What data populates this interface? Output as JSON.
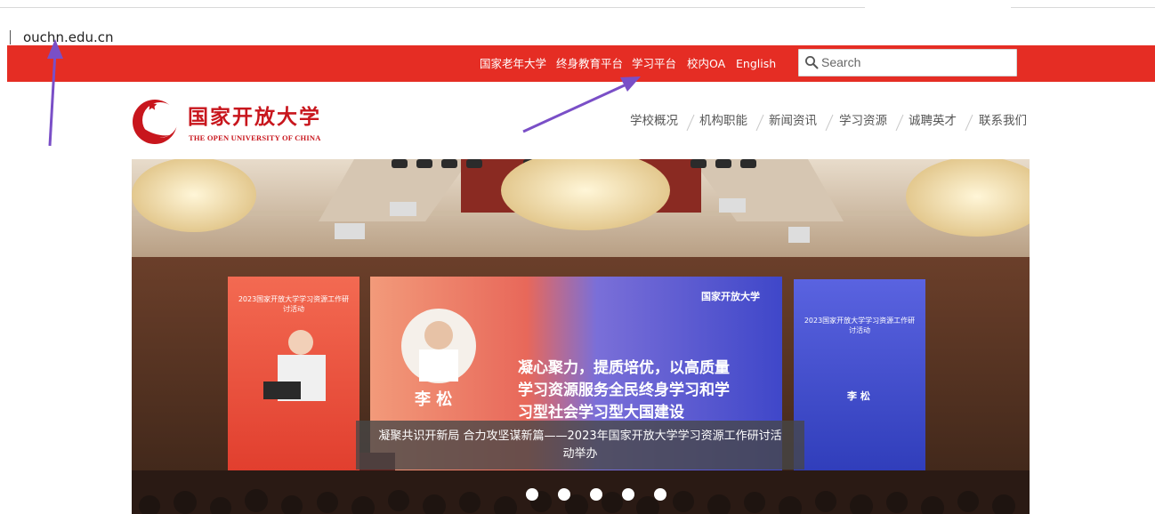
{
  "browser": {
    "url": "ouchn.edu.cn"
  },
  "utility_nav": {
    "links": [
      "国家老年大学",
      "终身教育平台",
      "学习平台",
      "校内OA",
      "English"
    ],
    "search_placeholder": "Search"
  },
  "logo": {
    "name_cn": "国家开放大学",
    "name_en": "THE OPEN UNIVERSITY OF CHINA"
  },
  "main_nav": [
    "学校概况",
    "机构职能",
    "新闻资讯",
    "学习资源",
    "诚聘英才",
    "联系我们"
  ],
  "banner": {
    "caption_line1": "凝聚共识开新局 合力攻坚谋新篇——2023年国家开放大学学习资源工作研讨活",
    "caption_line2": "动举办",
    "slide_count": 5,
    "screen_text": {
      "center_logo": "国家开放大学",
      "center_headline_1": "凝心聚力，提质培优，以高质量",
      "center_headline_2": "学习资源服务全民终身学习和学",
      "center_headline_3": "习型社会学习型大国建设",
      "speaker_name": "李 松",
      "right_name": "李 松",
      "left_title": "2023国家开放大学学习资源工作研讨活动",
      "right_title": "2023国家开放大学学习资源工作研讨活动"
    }
  },
  "colors": {
    "brand_red": "#e52d24",
    "logo_red": "#c8161d",
    "annotation_arrow": "#7a4fc7"
  },
  "icons": [
    "search-icon",
    "university-logo-icon",
    "annotation-arrow-icon"
  ]
}
